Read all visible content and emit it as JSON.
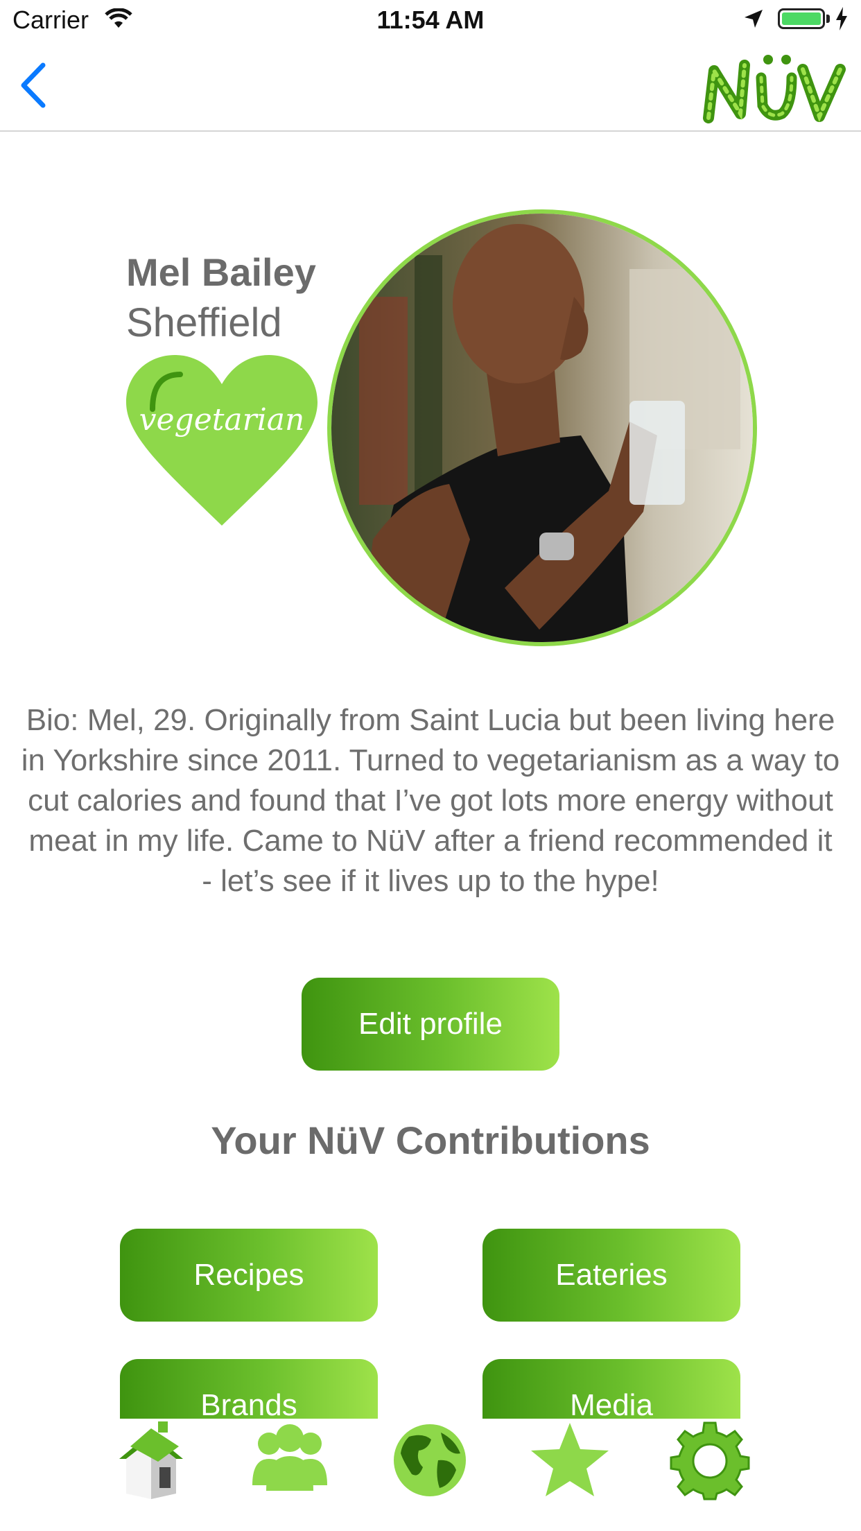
{
  "status_bar": {
    "carrier": "Carrier",
    "time": "11:54 AM"
  },
  "nav": {
    "logo_text": "NüV",
    "back_icon": "chevron-left-icon"
  },
  "profile": {
    "name": "Mel Bailey",
    "city": "Sheffield",
    "diet_badge": "vegetarian",
    "bio": "Bio: Mel, 29. Originally from Saint Lucia but been living here in Yorkshire since 2011. Turned to vegetarianism as a way to cut calories and found that I’ve got lots more energy without meat in my life. Came to NüV after a friend recommended it - let’s see if it lives up to the hype!"
  },
  "actions": {
    "edit_profile": "Edit profile"
  },
  "contributions": {
    "title": "Your NüV Contributions",
    "buttons": [
      "Recipes",
      "Eateries",
      "Brands",
      "Media"
    ]
  },
  "tab_bar": {
    "icons": [
      "home-icon",
      "community-icon",
      "globe-icon",
      "star-icon",
      "settings-icon"
    ]
  },
  "colors": {
    "brand_green": "#8ed84a",
    "dark_green": "#3f9410",
    "ios_blue": "#0a7aff"
  }
}
